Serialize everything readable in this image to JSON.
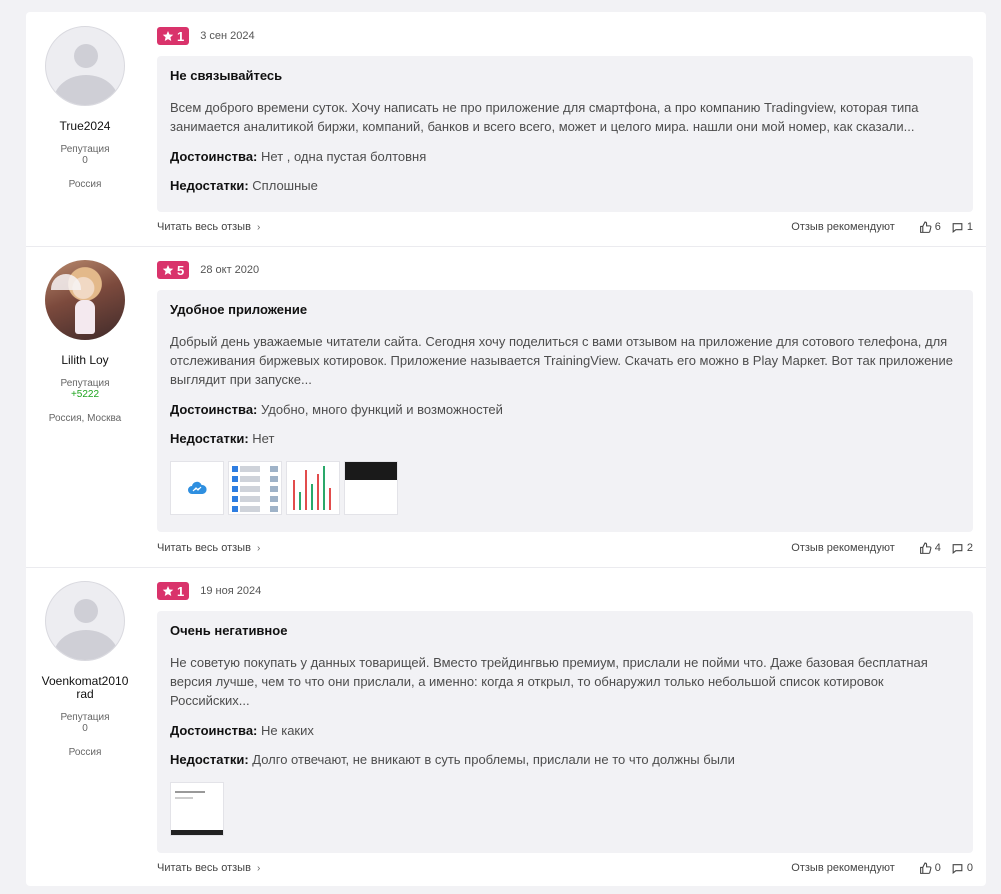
{
  "reviews": [
    {
      "user": {
        "name": "True2024",
        "reputation_label": "Репутация",
        "reputation": "0",
        "location": "Россия"
      },
      "rating": "1",
      "date": "3 сен 2024",
      "title": "Не связывайтесь",
      "text": "Всем доброго времени суток. Хочу написать не про приложение для смартфона, а про компанию Tradingview, которая типа занимается аналитикой биржи, компаний, банков и всего всего, может и целого мира. нашли они мой номер, как сказали...",
      "pros_label": "Достоинства:",
      "pros": " Нет , одна пустая болтовня",
      "cons_label": "Недостатки:",
      "cons": " Сплошные",
      "read_more": "Читать весь отзыв",
      "recommend": "Отзыв рекомендуют",
      "likes": "6",
      "comments": "1"
    },
    {
      "user": {
        "name": "Lilith Loy",
        "reputation_label": "Репутация",
        "reputation": "+5222",
        "location": "Россия, Москва"
      },
      "rating": "5",
      "date": "28 окт 2020",
      "title": "Удобное приложение",
      "text": "Добрый день уважаемые читатели сайта. Сегодня хочу поделиться с вами отзывом на приложение для сотового телефона, для отслеживания биржевых котировок. Приложение называется TrainingView. Скачать его можно в Play Маркет. Вот так приложение выглядит при запуске...",
      "pros_label": "Достоинства:",
      "pros": " Удобно, много функций и возможностей",
      "cons_label": "Недостатки:",
      "cons": " Нет",
      "read_more": "Читать весь отзыв",
      "recommend": "Отзыв рекомендуют",
      "likes": "4",
      "comments": "2"
    },
    {
      "user": {
        "name": "Voenkomat2010rad",
        "reputation_label": "Репутация",
        "reputation": "0",
        "location": "Россия"
      },
      "rating": "1",
      "date": "19 ноя 2024",
      "title": "Очень негативное",
      "text": "Не советую покупать у данных товарищей. Вместо трейдингвью премиум, прислали не пойми что. Даже базовая бесплатная версия лучше, чем то что они прислали, а именно: когда я открыл, то обнаружил только небольшой список котировок Российских...",
      "pros_label": "Достоинства:",
      "pros": " Не каких",
      "cons_label": "Недостатки:",
      "cons": " Долго отвечают, не вникают в суть проблемы, прислали не то что должны были",
      "read_more": "Читать весь отзыв",
      "recommend": "Отзыв рекомендуют",
      "likes": "0",
      "comments": "0"
    }
  ],
  "colors": {
    "badge": "#d9336b",
    "card_bg": "#f2f2f5",
    "positive": "#1fa51f"
  },
  "icons": [
    "star-icon",
    "thumbs-up-icon",
    "comment-icon",
    "chevron-right-icon",
    "cloud-icon"
  ]
}
